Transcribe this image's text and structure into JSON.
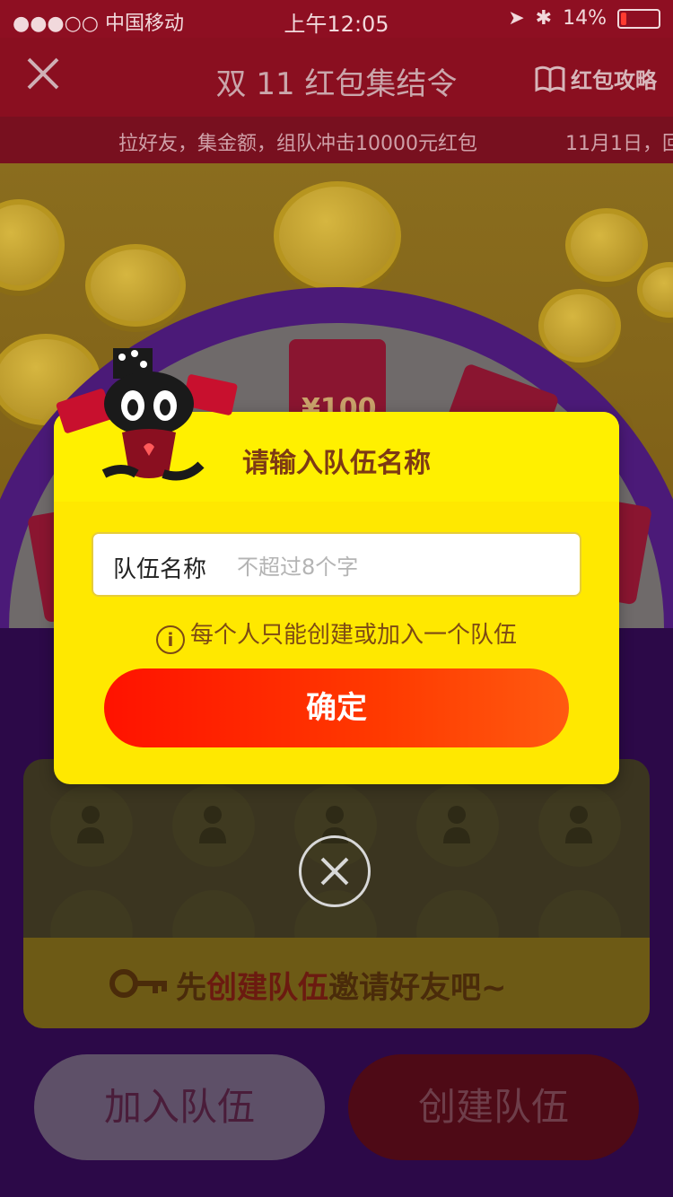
{
  "status_bar": {
    "carrier": "●●●○○ 中国移动",
    "time": "上午12:05",
    "battery_percent": "14%",
    "battery_level": 0.14
  },
  "nav": {
    "title": "双 11 红包集结令",
    "guide_label": "红包攻略"
  },
  "ticker": {
    "text": "拉好友，集金额，组队冲击10000元红包",
    "text2": "11月1日，回"
  },
  "wheel": {
    "prize_label": "¥100"
  },
  "dialog": {
    "title": "请输入队伍名称",
    "field_label": "队伍名称",
    "field_placeholder": "不超过8个字",
    "field_value": "",
    "notice": "每个人只能创建或加入一个队伍",
    "confirm_label": "确定"
  },
  "team_panel": {
    "banner_prefix": "先",
    "banner_highlight": "创建队伍",
    "banner_suffix": "邀请好友吧~"
  },
  "buttons": {
    "join_label": "加入队伍",
    "create_label": "创建队伍"
  },
  "colors": {
    "dialog_bg": "#ffe800",
    "confirm_start": "#ff1200",
    "confirm_end": "#ff5a10",
    "title_text": "#7d3a14"
  }
}
